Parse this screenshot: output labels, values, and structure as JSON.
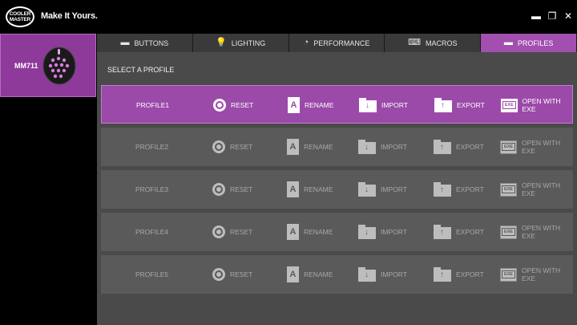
{
  "app": {
    "logo_line1": "COOLER",
    "logo_line2": "MASTER",
    "tagline": "Make It Yours."
  },
  "window_controls": {
    "minimize": "▬",
    "maximize": "❐",
    "close": "✕"
  },
  "device": {
    "name": "MM711",
    "icon": "mouse-icon"
  },
  "tabs": [
    {
      "label": "BUTTONS",
      "icon": "mouse-buttons-icon",
      "glyph": "▬"
    },
    {
      "label": "LIGHTING",
      "icon": "light-bulb-icon",
      "glyph": "💡"
    },
    {
      "label": "PERFORMANCE",
      "icon": "gauge-icon",
      "glyph": "◔"
    },
    {
      "label": "MACROS",
      "icon": "macro-icon",
      "glyph": "⌨"
    },
    {
      "label": "PROFILES",
      "icon": "profiles-icon",
      "glyph": "▬"
    }
  ],
  "active_tab": "PROFILES",
  "section_label": "SELECT A PROFILE",
  "actions": {
    "reset": "RESET",
    "rename": "RENAME",
    "rename_glyph": "A",
    "import": "IMPORT",
    "export": "EXPORT",
    "open_with_exe": "OPEN WITH EXE",
    "exe_glyph": "EXE"
  },
  "profiles": [
    {
      "name": "PROFILE1",
      "active": true
    },
    {
      "name": "PROFILE2",
      "active": false
    },
    {
      "name": "PROFILE3",
      "active": false
    },
    {
      "name": "PROFILE4",
      "active": false
    },
    {
      "name": "PROFILE5",
      "active": false
    }
  ],
  "colors": {
    "accent": "#a24fb0",
    "active_row": "#9b4aa9",
    "row": "#5a5a5a",
    "panel": "#4a4a4a"
  }
}
